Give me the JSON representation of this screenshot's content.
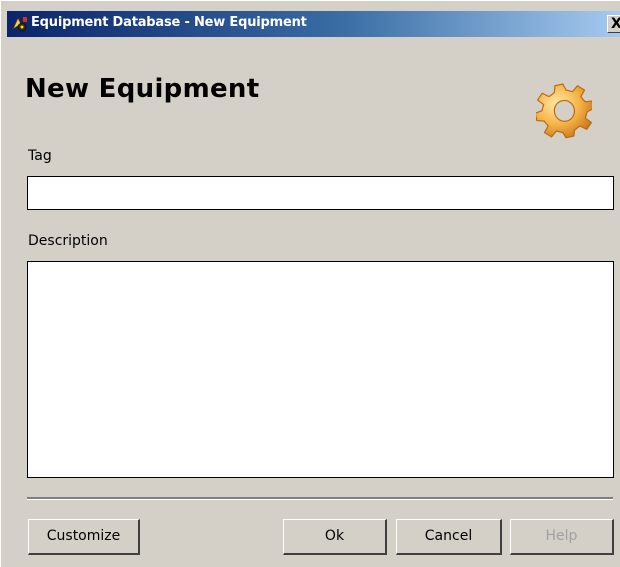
{
  "window": {
    "title": "Equipment Database - New Equipment",
    "close_glyph": "X",
    "app_icon": "equipment-app-icon"
  },
  "header": {
    "heading": "New Equipment",
    "icon": "gear-icon"
  },
  "form": {
    "tag": {
      "label": "Tag",
      "value": "",
      "placeholder": ""
    },
    "description": {
      "label": "Description",
      "value": "",
      "placeholder": ""
    }
  },
  "buttons": {
    "customize": "Customize",
    "ok": "Ok",
    "cancel": "Cancel",
    "help": "Help",
    "help_enabled": false
  },
  "colors": {
    "dialog_background": "#d4d0c8",
    "titlebar_start": "#0a246a",
    "titlebar_end": "#a6caf0",
    "gear": "#f2a93b",
    "disabled_text": "#a0a0a0"
  }
}
